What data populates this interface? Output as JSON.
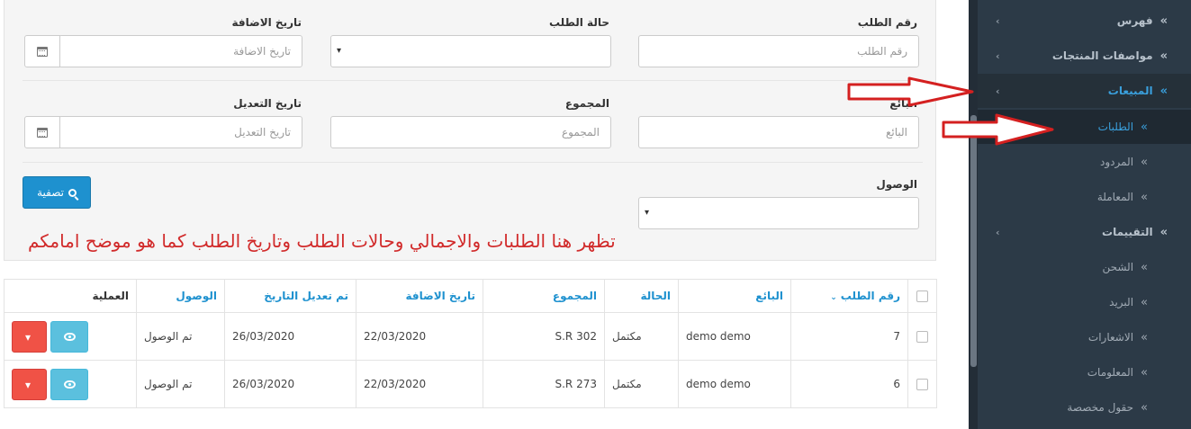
{
  "sidebar": {
    "items": [
      {
        "label": "فهرس",
        "type": "main"
      },
      {
        "label": "مواصفات المنتجات",
        "type": "main"
      },
      {
        "label": "المبيعات",
        "type": "main-active"
      },
      {
        "label": "الطلبات",
        "type": "sub-current"
      },
      {
        "label": "المردود",
        "type": "sub"
      },
      {
        "label": "المعاملة",
        "type": "sub"
      },
      {
        "label": "التقييمات",
        "type": "main"
      },
      {
        "label": "الشحن",
        "type": "sub"
      },
      {
        "label": "البريد",
        "type": "sub"
      },
      {
        "label": "الاشعارات",
        "type": "sub"
      },
      {
        "label": "المعلومات",
        "type": "sub"
      },
      {
        "label": "حقول مخصصة",
        "type": "sub"
      }
    ]
  },
  "filters": {
    "order_id_label": "رقم الطلب",
    "order_id_placeholder": "رقم الطلب",
    "status_label": "حالة الطلب",
    "date_added_label": "تاريخ الاضافة",
    "date_added_placeholder": "تاريخ الاضافة",
    "seller_label": "البائع",
    "seller_placeholder": "البائع",
    "total_label": "المجموع",
    "total_placeholder": "المجموع",
    "date_modified_label": "تاريخ التعديل",
    "date_modified_placeholder": "تاريخ التعديل",
    "arrival_label": "الوصول",
    "filter_button": "تصفية"
  },
  "annotation": "تظهر هنا الطلبات والاجمالي وحالات الطلب وتاريخ الطلب كما هو موضح امامكم",
  "table": {
    "headers": {
      "order_id": "رقم الطلب",
      "seller": "البائع",
      "status": "الحالة",
      "total": "المجموع",
      "date_added": "تاريخ الاضافة",
      "date_modified": "تم تعديل التاريخ",
      "arrival": "الوصول",
      "action": "العملية"
    },
    "rows": [
      {
        "order_id": "7",
        "seller": "demo demo",
        "status": "مكتمل",
        "total": "S.R 302",
        "date_added": "22/03/2020",
        "date_modified": "26/03/2020",
        "arrival": "تم الوصول"
      },
      {
        "order_id": "6",
        "seller": "demo demo",
        "status": "مكتمل",
        "total": "S.R 273",
        "date_added": "22/03/2020",
        "date_modified": "26/03/2020",
        "arrival": "تم الوصول"
      }
    ]
  },
  "colors": {
    "primary": "#1e91cf",
    "annotation": "#d12a2a",
    "sidebar_bg": "#2c3a47",
    "active_link": "#3aa0dd"
  }
}
